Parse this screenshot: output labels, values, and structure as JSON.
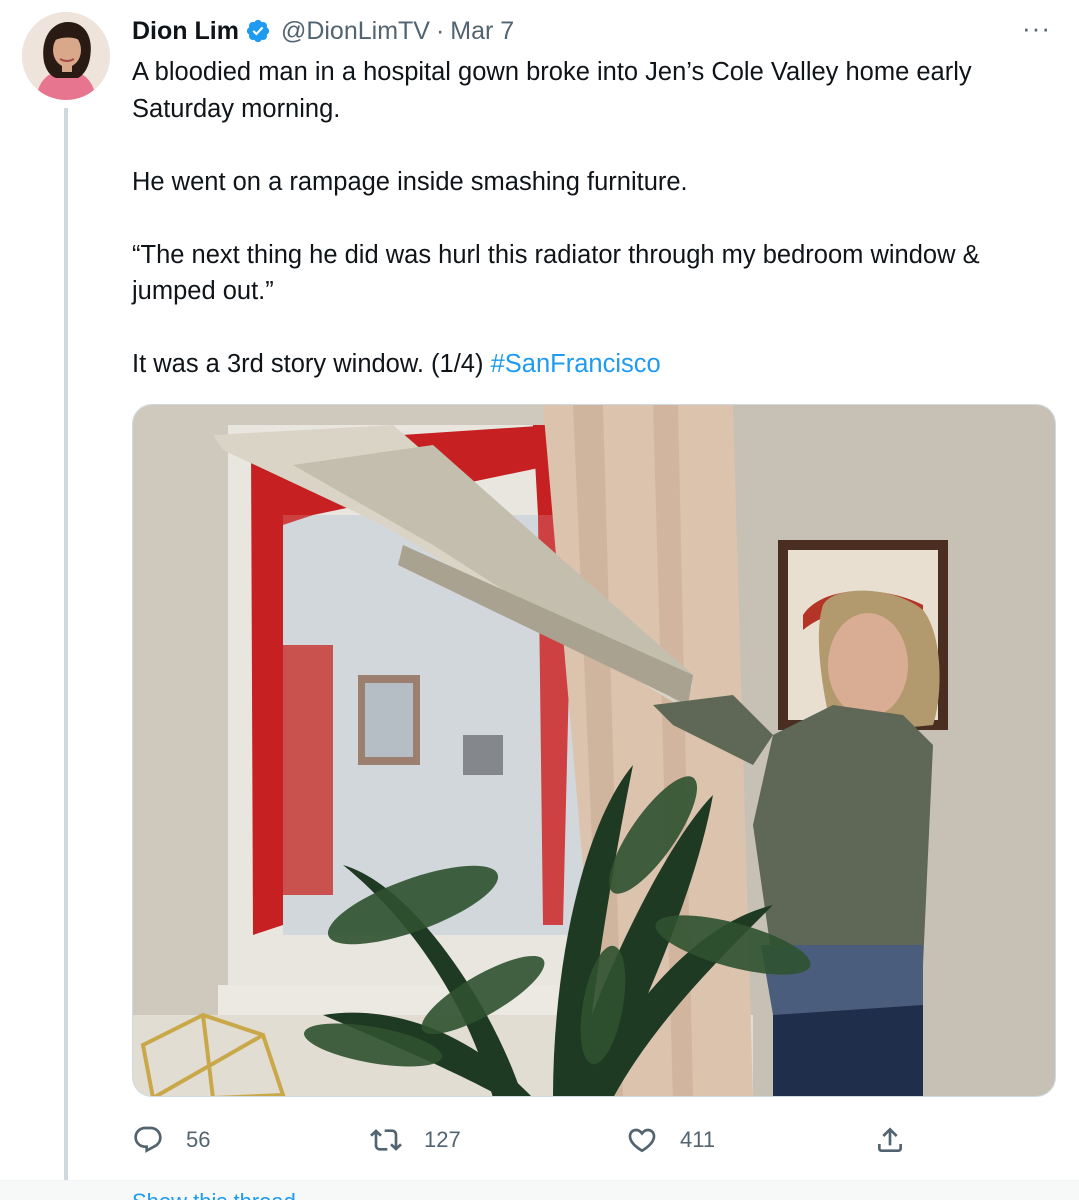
{
  "tweet": {
    "author_name": "Dion Lim",
    "handle": "@DionLimTV",
    "separator": "·",
    "date": "Mar 7",
    "more_label": "···",
    "paragraphs": [
      "A bloodied man in a hospital gown broke into Jen’s Cole Valley home early Saturday morning.",
      "He went on a rampage inside smashing furniture.",
      "“The next thing he did was hurl this radiator through my bedroom window & jumped out.”",
      "It was a 3rd story window. (1/4)"
    ],
    "hashtag": "#SanFrancisco"
  },
  "actions": {
    "replies": "56",
    "retweets": "127",
    "likes": "411"
  },
  "footer": {
    "show_thread": "Show this thread"
  },
  "colors": {
    "accent": "#1d9bf0",
    "text": "#0f1419",
    "muted": "#536471",
    "thread_line": "#cfd9de"
  },
  "icons": {
    "verified": "verified-badge-icon",
    "more": "more-options-icon",
    "reply": "reply-icon",
    "retweet": "retweet-icon",
    "like": "heart-icon",
    "share": "share-icon"
  }
}
